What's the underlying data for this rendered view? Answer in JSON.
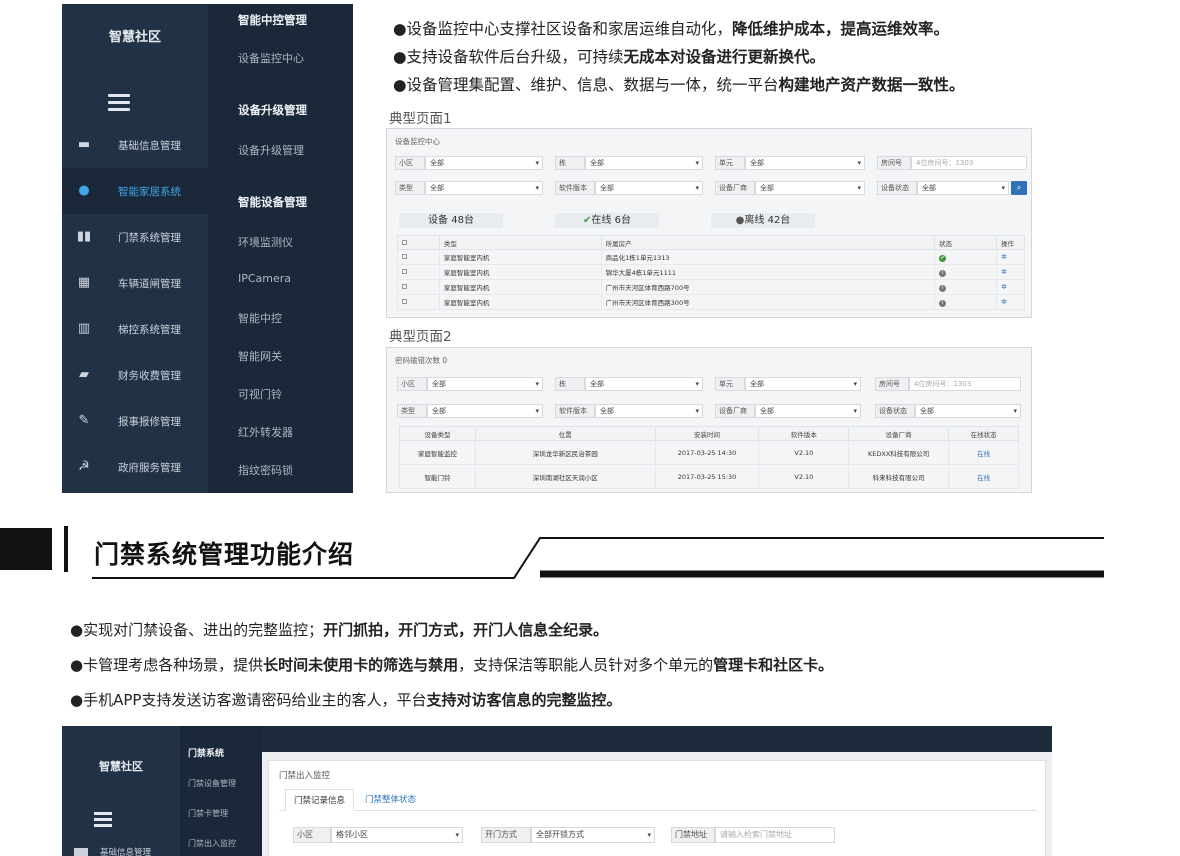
{
  "panel1": {
    "brand": "智慧社区",
    "left_items": [
      {
        "label": "基础信息管理",
        "icon": "id-card-icon",
        "glyph": "▬"
      },
      {
        "label": "智能家居系统",
        "icon": "brain-icon",
        "glyph": "●"
      },
      {
        "label": "门禁系统管理",
        "icon": "door-icon",
        "glyph": "▮▮"
      },
      {
        "label": "车辆道闸管理",
        "icon": "gate-icon",
        "glyph": "▦"
      },
      {
        "label": "梯控系统管理",
        "icon": "elevator-icon",
        "glyph": "▥"
      },
      {
        "label": "财务收费管理",
        "icon": "wallet-icon",
        "glyph": "▰"
      },
      {
        "label": "报事报修管理",
        "icon": "tools-icon",
        "glyph": "✎"
      },
      {
        "label": "政府服务管理",
        "icon": "emblem-icon",
        "glyph": "☭"
      }
    ],
    "sections": [
      {
        "title": "智能中控管理",
        "items": [
          "设备监控中心"
        ]
      },
      {
        "title": "设备升级管理",
        "items": [
          "设备升级管理"
        ]
      },
      {
        "title": "智能设备管理",
        "items": [
          "环境监测仪",
          "IPCamera",
          "智能中控",
          "智能网关",
          "可视门铃",
          "红外转发器",
          "指纹密码锁"
        ]
      }
    ]
  },
  "top_bullets": [
    {
      "normal": "●设备监控中心支撑社区设备和家居运维自动化，",
      "bold": "降低维护成本，提高运维效率。"
    },
    {
      "normal": "●支持设备软件后台升级，可持续",
      "bold": "无成本对设备进行更新换代。"
    },
    {
      "normal": "●设备管理集配置、维护、信息、数据与一体，统一平台",
      "bold": "构建地产资产数据一致性。"
    }
  ],
  "page1": {
    "caption": "典型页面1",
    "title": "设备监控中心",
    "filters_row1": [
      {
        "label": "小区",
        "value": "全部"
      },
      {
        "label": "栋",
        "value": "全部"
      },
      {
        "label": "单元",
        "value": "全部"
      }
    ],
    "room_label": "房间号",
    "room_placeholder": "4位房间号：1303",
    "filters_row2": [
      {
        "label": "类型",
        "value": "全部"
      },
      {
        "label": "软件版本",
        "value": "全部"
      },
      {
        "label": "设备厂商",
        "value": "全部"
      },
      {
        "label": "设备状态",
        "value": "全部"
      }
    ],
    "stats": {
      "total": "设备 48台",
      "online": "在线 6台",
      "offline": "离线 42台"
    },
    "headers": [
      "类型",
      "所属房产",
      "状态",
      "操作"
    ],
    "rows": [
      {
        "type": "家庭智能室内机",
        "property": "商品化1栋1单元1313",
        "status": "online"
      },
      {
        "type": "家庭智能室内机",
        "property": "锦华大厦4栋1单元1111",
        "status": "offline"
      },
      {
        "type": "家庭智能室内机",
        "property": "广州市天河区体育西路700号",
        "status": "offline"
      },
      {
        "type": "家庭智能室内机",
        "property": "广州市天河区体育西路300号",
        "status": "offline"
      }
    ]
  },
  "page2": {
    "caption": "典型页面2",
    "title": "密码输错次数 0",
    "filters_row1": [
      {
        "label": "小区",
        "value": "全部"
      },
      {
        "label": "栋",
        "value": "全部"
      },
      {
        "label": "单元",
        "value": "全部"
      }
    ],
    "room_label": "房间号",
    "room_placeholder": "4位房间号：1303",
    "filters_row2": [
      {
        "label": "类型",
        "value": "全部"
      },
      {
        "label": "软件版本",
        "value": "全部"
      },
      {
        "label": "设备厂商",
        "value": "全部"
      },
      {
        "label": "设备状态",
        "value": "全部"
      }
    ],
    "headers": [
      "设备类型",
      "位置",
      "安装时间",
      "软件版本",
      "设备厂商",
      "在线状态"
    ],
    "rows": [
      [
        "家庭智能监控",
        "深圳龙华新区民治茶园",
        "2017-03-25 14:30",
        "V2.10",
        "KEDXX科技有限公司",
        "在线"
      ],
      [
        "智能门铃",
        "深圳南湖社区天润小区",
        "2017-03-25 15:30",
        "V2.10",
        "科来科技有限公司",
        "在线"
      ]
    ]
  },
  "section_title": "门禁系统管理功能介绍",
  "bottom_bullets": [
    {
      "parts": [
        {
          "t": "●实现对门禁设备、进出的完整监控；",
          "b": false
        },
        {
          "t": "开门抓拍，开门方式，开门人信息全纪录。",
          "b": true
        }
      ]
    },
    {
      "parts": [
        {
          "t": "●卡管理考虑各种场景，提供",
          "b": false
        },
        {
          "t": "长时间未使用卡的筛选与禁用",
          "b": true
        },
        {
          "t": "，支持保洁等职能人员针对多个单元的",
          "b": false
        },
        {
          "t": "管理卡和社区卡。",
          "b": true
        }
      ]
    },
    {
      "parts": [
        {
          "t": "●手机APP支持发送访客邀请密码给业主的客人，平台",
          "b": false
        },
        {
          "t": "支持对访客信息的完整监控。",
          "b": true
        }
      ]
    }
  ],
  "panel2": {
    "brand": "智慧社区",
    "section": "门禁系统",
    "items": [
      "门禁设备管理",
      "门禁卡管理",
      "门禁出入监控"
    ],
    "left_item": "基础信息管理",
    "content_title": "门禁出入监控",
    "tabs": [
      "门禁记录信息",
      "门禁整体状态"
    ],
    "filters": [
      {
        "label": "小区",
        "value": "格邻小区"
      },
      {
        "label": "开门方式",
        "value": "全部开锁方式"
      }
    ],
    "addr_label": "门禁地址",
    "addr_placeholder": "请输入检索门禁地址"
  },
  "colors": {
    "sidebar": "#223246",
    "accent": "#3ea7e8",
    "link": "#2e73b8",
    "online": "#3c9a3c"
  }
}
